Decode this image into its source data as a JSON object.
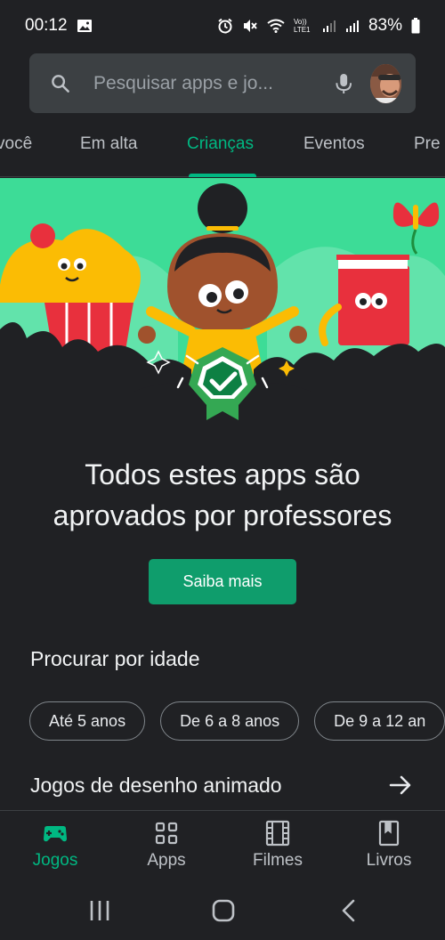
{
  "status_bar": {
    "time": "00:12",
    "network_label": "Vo)) LTE1",
    "battery": "83%"
  },
  "search": {
    "placeholder": "Pesquisar apps e jo..."
  },
  "tabs": [
    {
      "label": "você"
    },
    {
      "label": "Em alta"
    },
    {
      "label": "Crianças",
      "active": true
    },
    {
      "label": "Eventos"
    },
    {
      "label": "Pre"
    }
  ],
  "promo": {
    "headline_line1": "Todos estes apps são",
    "headline_line2": "aprovados por professores",
    "cta": "Saiba mais"
  },
  "age_section": {
    "title": "Procurar por idade",
    "chips": [
      "Até 5 anos",
      "De 6 a 8 anos",
      "De 9 a 12 an"
    ]
  },
  "cartoon_section": {
    "title": "Jogos de desenho animado"
  },
  "bottom_nav": [
    {
      "label": "Jogos",
      "icon": "gamepad-icon",
      "active": true
    },
    {
      "label": "Apps",
      "icon": "apps-grid-icon"
    },
    {
      "label": "Filmes",
      "icon": "film-icon"
    },
    {
      "label": "Livros",
      "icon": "book-icon"
    }
  ],
  "colors": {
    "accent": "#00b882",
    "background": "#202124",
    "banner_green": "#3ddc97"
  }
}
